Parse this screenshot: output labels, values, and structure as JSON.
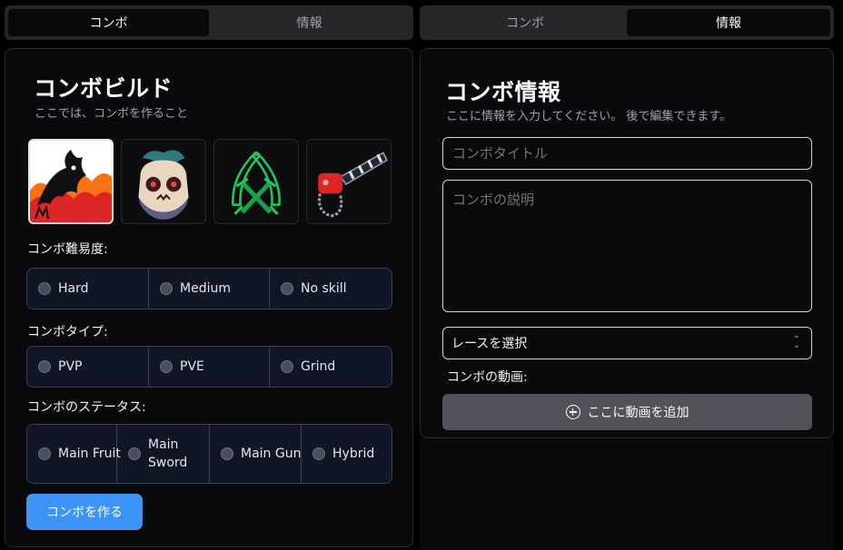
{
  "left_tabs": [
    {
      "label": "コンボ",
      "active": true
    },
    {
      "label": "情報",
      "active": false
    }
  ],
  "right_tabs": [
    {
      "label": "コンボ",
      "active": false
    },
    {
      "label": "情報",
      "active": true
    }
  ],
  "builder": {
    "title": "コンボビルド",
    "subtitle": "ここでは、コンボを作ること",
    "icons": [
      {
        "name": "dragon-fruit-icon",
        "selected": true
      },
      {
        "name": "skull-fruit-icon",
        "selected": false
      },
      {
        "name": "crossed-swords-icon",
        "selected": false
      },
      {
        "name": "red-gun-icon",
        "selected": false
      }
    ],
    "difficulty": {
      "label": "コンボ難易度:",
      "options": [
        "Hard",
        "Medium",
        "No skill"
      ]
    },
    "type": {
      "label": "コンボタイプ:",
      "options": [
        "PVP",
        "PVE",
        "Grind"
      ]
    },
    "status": {
      "label": "コンボのステータス:",
      "options": [
        "Main Fruit",
        "Main Sword",
        "Main Gun",
        "Hybrid"
      ]
    },
    "create_button": "コンボを作る"
  },
  "info": {
    "title": "コンボ情報",
    "subtitle": "ここに情報を入力してください。 後で編集できます。",
    "title_placeholder": "コンボタイトル",
    "description_placeholder": "コンボの説明",
    "race_select": "レースを選択",
    "video_label": "コンボの動画:",
    "add_video_button": "ここに動画を追加"
  },
  "colors": {
    "accent_blue": "#3d94f6",
    "radio_group_bg": "#101626",
    "panel_bg": "#0a0a0c"
  }
}
